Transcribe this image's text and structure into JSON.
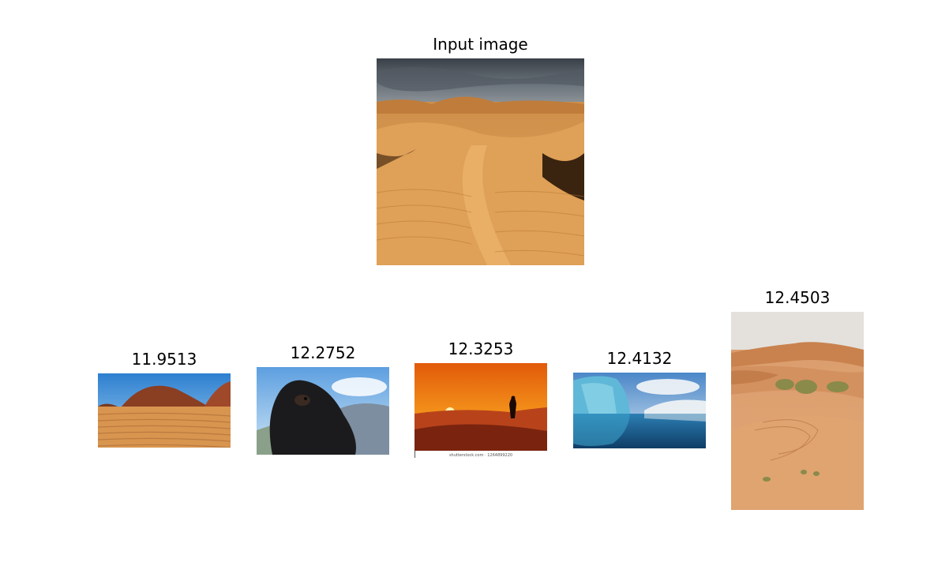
{
  "input": {
    "title": "Input image",
    "image": "desert-dunes-stormy-sky"
  },
  "results": [
    {
      "score": "11.9513",
      "image": "desert-rock-outcrop-sand-ripples"
    },
    {
      "score": "12.2752",
      "image": "black-long-haired-dog"
    },
    {
      "score": "12.3253",
      "image": "desert-sunset-silhouette"
    },
    {
      "score": "12.4132",
      "image": "glacier-ice-reflection"
    },
    {
      "score": "12.4503",
      "image": "desert-dunes-with-shrubs"
    }
  ],
  "watermark": "shutterstock.com · 1264899220"
}
